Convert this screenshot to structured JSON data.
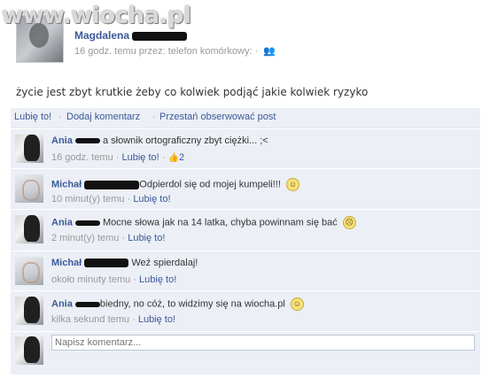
{
  "watermark": "www.wiocha.pl",
  "post": {
    "author": "Magdalena",
    "meta": "16 godz. temu przez: telefon komórkowy: ·",
    "text": "życie jest zbyt krutkie żeby co kolwiek podjąć jakie kolwiek ryzyko"
  },
  "actions": {
    "like": "Lubię to!",
    "comment": "Dodaj komentarz",
    "unfollow": "Przestań obserwować post",
    "separator": "·"
  },
  "comments": [
    {
      "name": "Ania",
      "text": "a słownik ortograficzny zbyt ciężki... ;<",
      "time": "16 godz. temu",
      "like": "Lubię to!",
      "likes": "2",
      "emoticon": false
    },
    {
      "name": "Michał",
      "text": "Odpierdol się od mojej kumpeli!!!",
      "time": "10 minut(y) temu",
      "like": "Lubię to!",
      "emoticon": true
    },
    {
      "name": "Ania",
      "text": "Mocne słowa jak na 14 latka, chyba powinnam się bać",
      "time": "2 minut(y) temu",
      "like": "Lubię to!",
      "emoticon": true
    },
    {
      "name": "Michał",
      "text": "Weź spierdalaj!",
      "time": "około minuty temu",
      "like": "Lubię to!",
      "emoticon": false
    },
    {
      "name": "Ania",
      "text": "biedny, no cóż, to widzimy się na wiocha.pl",
      "time": "kilka sekund temu",
      "like": "Lubię to!",
      "emoticon": true
    }
  ],
  "composer": {
    "placeholder": "Napisz komentarz..."
  }
}
